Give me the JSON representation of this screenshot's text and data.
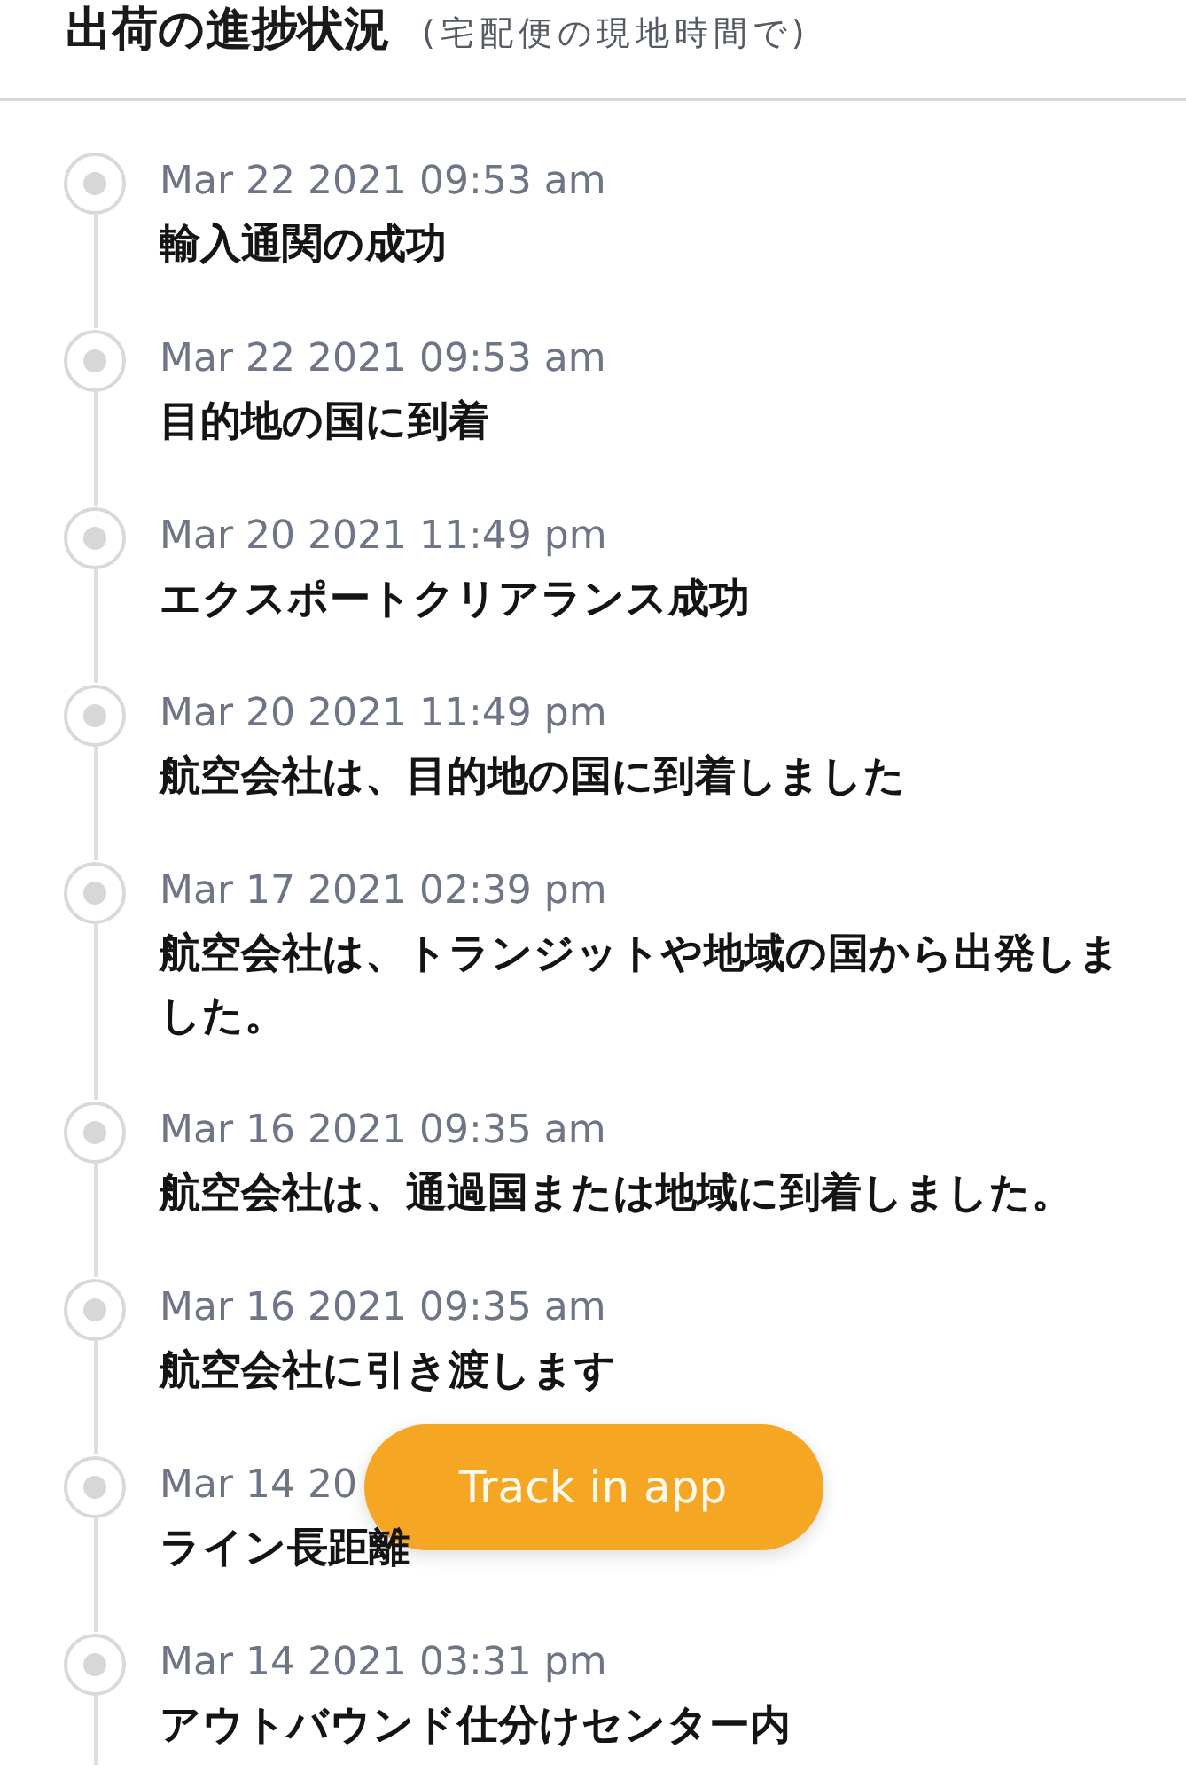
{
  "header": {
    "title": "出荷の進捗状況",
    "subtitle": "(宅配便の現地時間で)"
  },
  "events": [
    {
      "date": "Mar 22 2021 09:53 am",
      "description": "輸入通関の成功"
    },
    {
      "date": "Mar 22 2021 09:53 am",
      "description": "目的地の国に到着"
    },
    {
      "date": "Mar 20 2021 11:49 pm",
      "description": "エクスポートクリアランス成功"
    },
    {
      "date": "Mar 20 2021 11:49 pm",
      "description": "航空会社は、目的地の国に到着しました"
    },
    {
      "date": "Mar 17 2021 02:39 pm",
      "description": "航空会社は、トランジットや地域の国から出発しました。"
    },
    {
      "date": "Mar 16 2021 09:35 am",
      "description": "航空会社は、通過国または地域に到着しました。"
    },
    {
      "date": "Mar 16 2021 09:35 am",
      "description": "航空会社に引き渡します"
    },
    {
      "date": "Mar 14 20",
      "description": "ライン長距離"
    },
    {
      "date": "Mar 14 2021 03:31 pm",
      "description": "アウトバウンド仕分けセンター内"
    }
  ],
  "floating_button": {
    "label": "Track in app"
  }
}
